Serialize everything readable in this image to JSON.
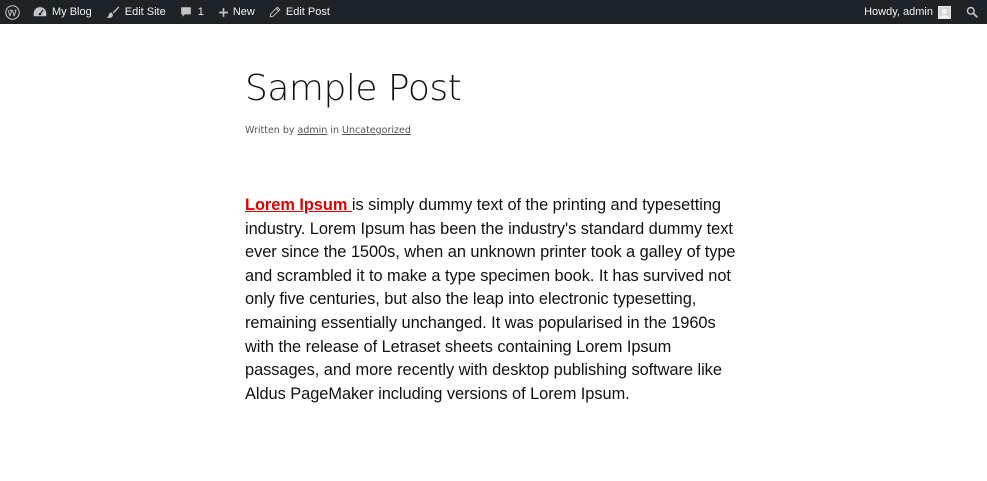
{
  "adminbar": {
    "site_name": "My Blog",
    "edit_site": "Edit Site",
    "comments_count": "1",
    "new_label": "New",
    "edit_post": "Edit Post",
    "greeting": "Howdy, admin",
    "icons": {
      "logo": "wordpress-icon",
      "site": "dashboard-icon",
      "edit_site": "brush-icon",
      "comments": "comment-icon",
      "new": "plus-icon",
      "edit_post": "pencil-icon",
      "avatar": "avatar-icon",
      "search": "search-icon"
    }
  },
  "post": {
    "title": "Sample Post",
    "meta": {
      "written_by": "Written by",
      "author": "admin",
      "in": "in",
      "category": "Uncategorized"
    },
    "body": {
      "link_text": "Lorem Ipsum ",
      "text": "is simply dummy text of the printing and typesetting industry. Lorem Ipsum has been the industry's standard dummy text ever since the 1500s, when an unknown printer took a galley of type and scrambled it to make a type specimen book. It has survived not only five centuries, but also the leap into electronic typesetting, remaining essentially unchanged. It was popularised in the 1960s with the release of Letraset sheets containing Lorem Ipsum passages, and more recently with desktop publishing software like Aldus PageMaker including versions of Lorem Ipsum."
    }
  },
  "colors": {
    "adminbar_bg": "#1d2327",
    "adminbar_text": "#f0f0f1",
    "link_red": "#e00000"
  }
}
